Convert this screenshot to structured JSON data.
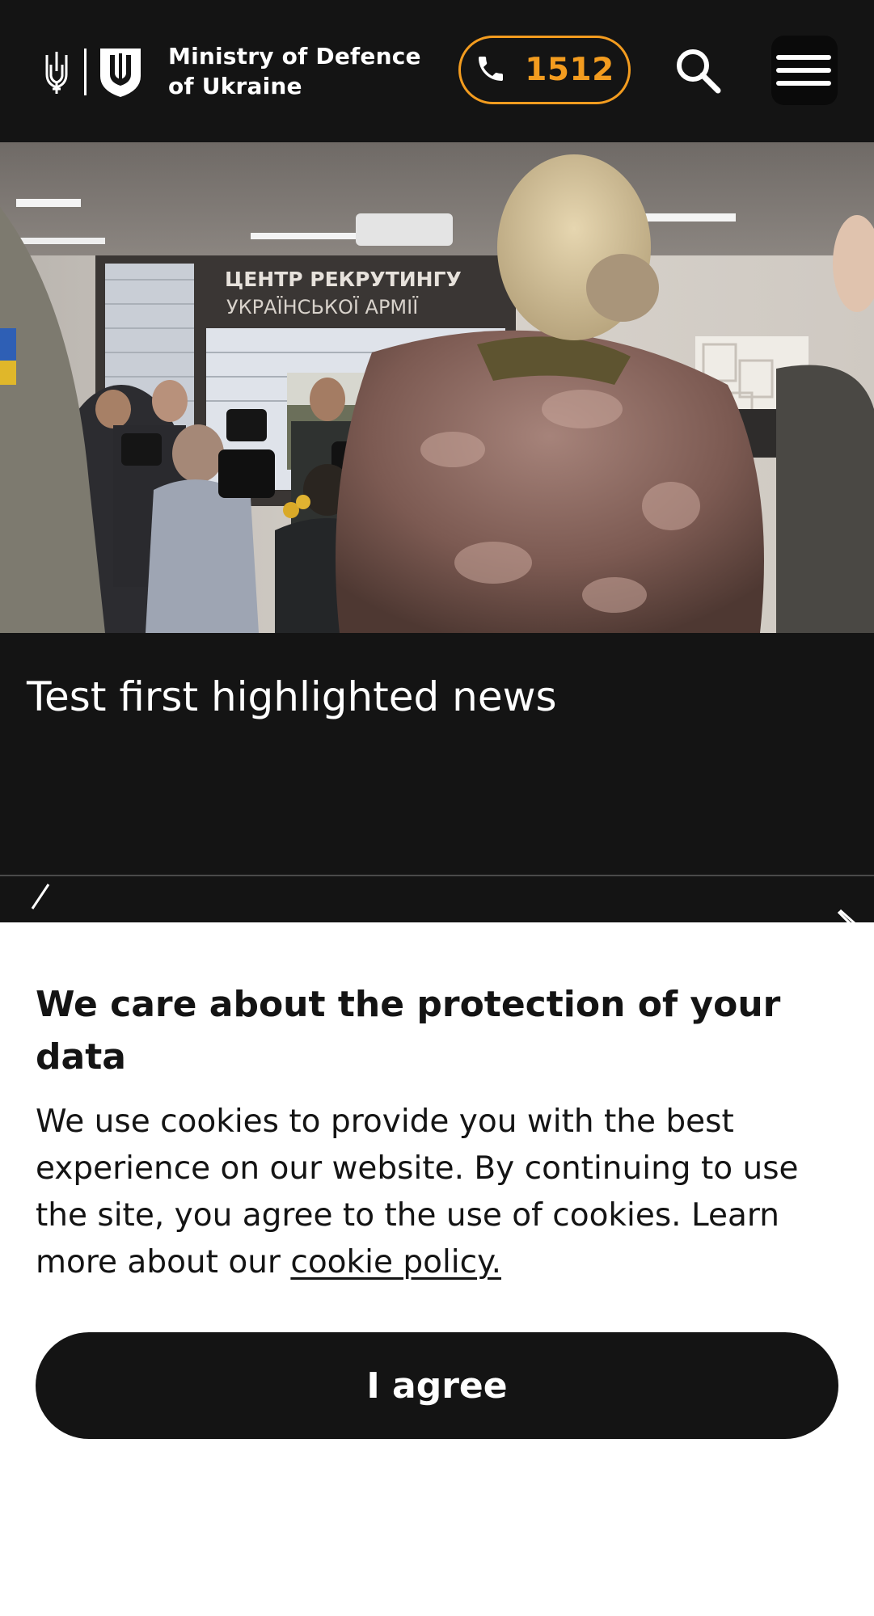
{
  "header": {
    "brand_line1": "Ministry of Defence",
    "brand_line2": "of Ukraine",
    "hotline_number": "1512",
    "icons": {
      "trident": "trident-icon",
      "shield": "shield-emblem-icon",
      "phone": "phone-icon",
      "search": "search-icon",
      "menu": "hamburger-menu-icon"
    }
  },
  "hero": {
    "photo_sign_line1": "ЦЕНТР РЕКРУТИНГУ",
    "photo_sign_line2": "УКРАЇНСЬКОЇ АРМІЇ"
  },
  "news": {
    "title": "Test first highlighted news",
    "nav_icons": [
      "chevron-left-icon",
      "chevron-right-icon"
    ]
  },
  "cookie_banner": {
    "title": "We care about the protection of your data",
    "text": "We use cookies to provide you with the best experience on our website. By continuing to use the site, you agree to the use of cookies. Learn more about our",
    "link_text": "cookie policy.",
    "agree_label": "I agree"
  },
  "colors": {
    "background": "#141414",
    "accent": "#f39c1f",
    "banner_background": "#ffffff",
    "text_dark": "#141414"
  }
}
